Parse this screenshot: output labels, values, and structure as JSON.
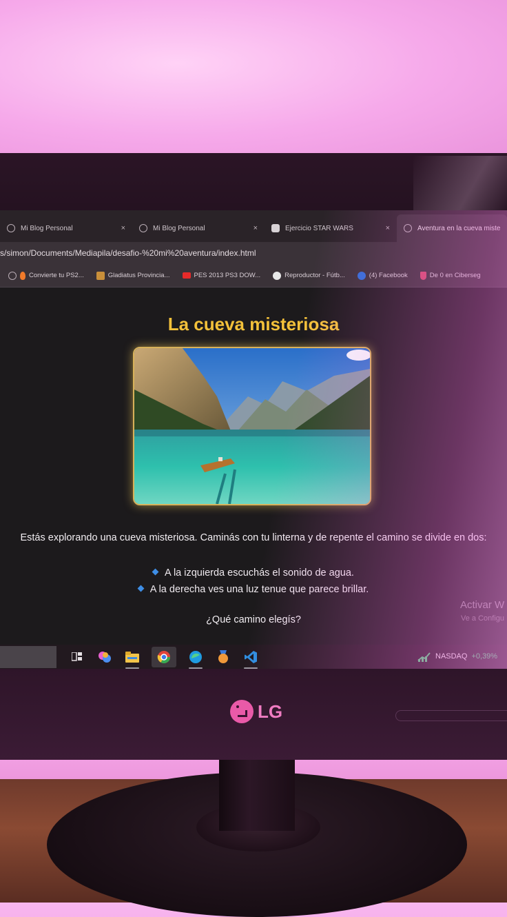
{
  "browser": {
    "tabs": [
      {
        "title": "Mi Blog Personal",
        "active": false
      },
      {
        "title": "Mi Blog Personal",
        "active": false
      },
      {
        "title": "Ejercicio STAR WARS",
        "active": false
      },
      {
        "title": "Aventura en la cueva miste",
        "active": true
      }
    ],
    "tab_close_glyph": "×",
    "address": "s/simon/Documents/Mediapila/desafio-%20mi%20aventura/index.html",
    "bookmarks": [
      {
        "label": "Convierte tu PS2...",
        "icon": "fire-icon"
      },
      {
        "label": "Gladiatus Provincia...",
        "icon": "gladiator-icon"
      },
      {
        "label": "PES 2013 PS3 DOW...",
        "icon": "youtube-icon"
      },
      {
        "label": "Reproductor - Fútb...",
        "icon": "soccer-icon"
      },
      {
        "label": "(4) Facebook",
        "icon": "facebook-icon"
      },
      {
        "label": "De 0 en Ciberseg",
        "icon": "shield-icon"
      }
    ]
  },
  "page": {
    "title": "La cueva misteriosa",
    "intro": "Estás explorando una cueva misteriosa. Caminás con tu linterna y de repente el camino se divide en dos:",
    "options": [
      "A la izquierda escuchás el sonido de agua.",
      "A la derecha ves una luz tenue que parece brillar."
    ],
    "question": "¿Qué camino elegís?",
    "watermark": "Activar W",
    "watermark_sub": "Ve a Configu"
  },
  "taskbar": {
    "ticker": "NASDAQ",
    "ticker_change": "+0,39%"
  },
  "monitor": {
    "brand": "LG"
  }
}
